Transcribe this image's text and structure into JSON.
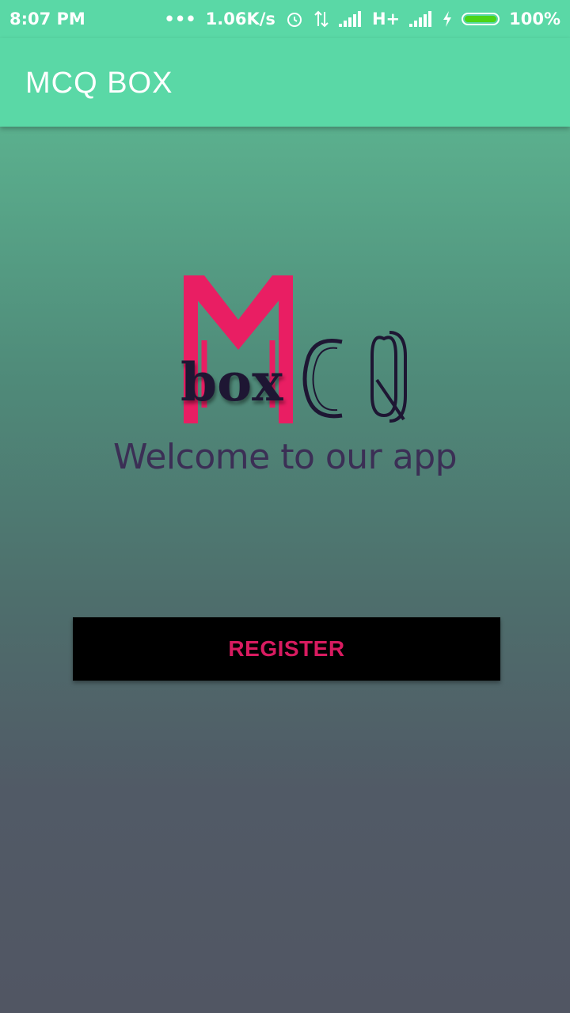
{
  "status_bar": {
    "time": "8:07 PM",
    "network_speed": "1.06K/s",
    "network_type": "H+",
    "battery": "100%",
    "icons": [
      "dots-icon",
      "alarm-icon",
      "data-transfer-icon",
      "signal-icon",
      "signal-icon",
      "charging-icon",
      "battery-icon"
    ]
  },
  "app_bar": {
    "title": "MCQ BOX"
  },
  "logo": {
    "letters": "CQ",
    "word": "box",
    "colors": {
      "m": "#e91e63",
      "text": "#1e1633"
    }
  },
  "welcome_text": "Welcome to our app",
  "register_button": {
    "label": "REGISTER"
  },
  "colors": {
    "accent": "#5ad8a6",
    "button_text": "#d81b60"
  }
}
